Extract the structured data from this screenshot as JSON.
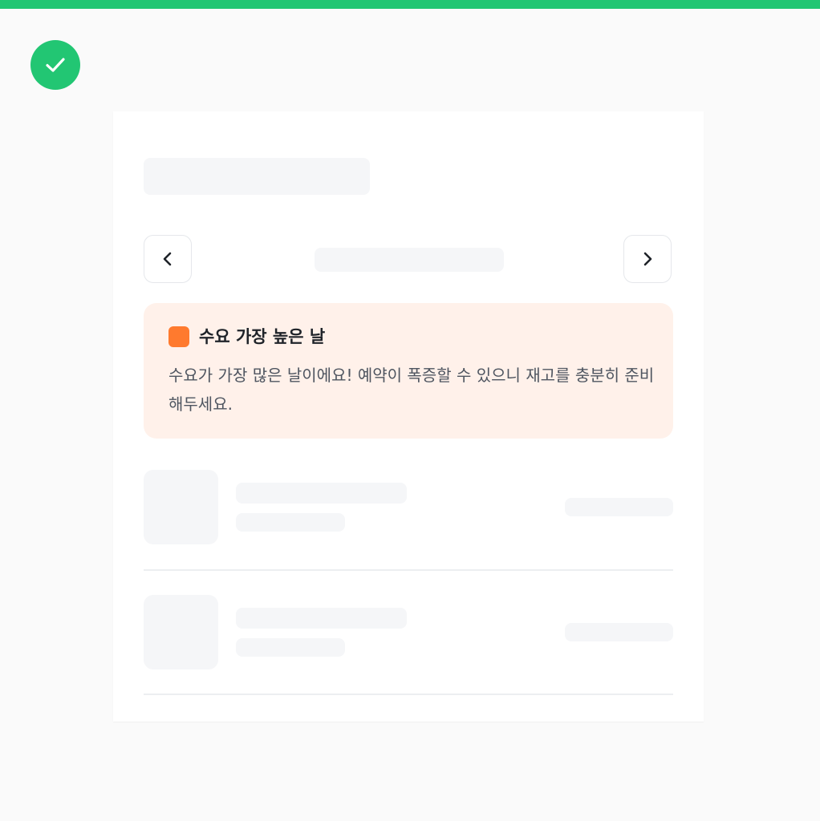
{
  "colors": {
    "accent": "#22c673",
    "notice_background": "#fff1ea",
    "notice_marker": "#ff7a2e",
    "skeleton": "#f5f6f8"
  },
  "status_icon": "check-icon",
  "navigation": {
    "prev_icon": "chevron-left-icon",
    "next_icon": "chevron-right-icon"
  },
  "notice": {
    "title": "수요 가장 높은 날",
    "body": "수요가 가장 많은 날이에요! 예약이 폭증할 수 있으니 재고를 충분히 준비해두세요."
  },
  "list_item_count_visible": 2
}
